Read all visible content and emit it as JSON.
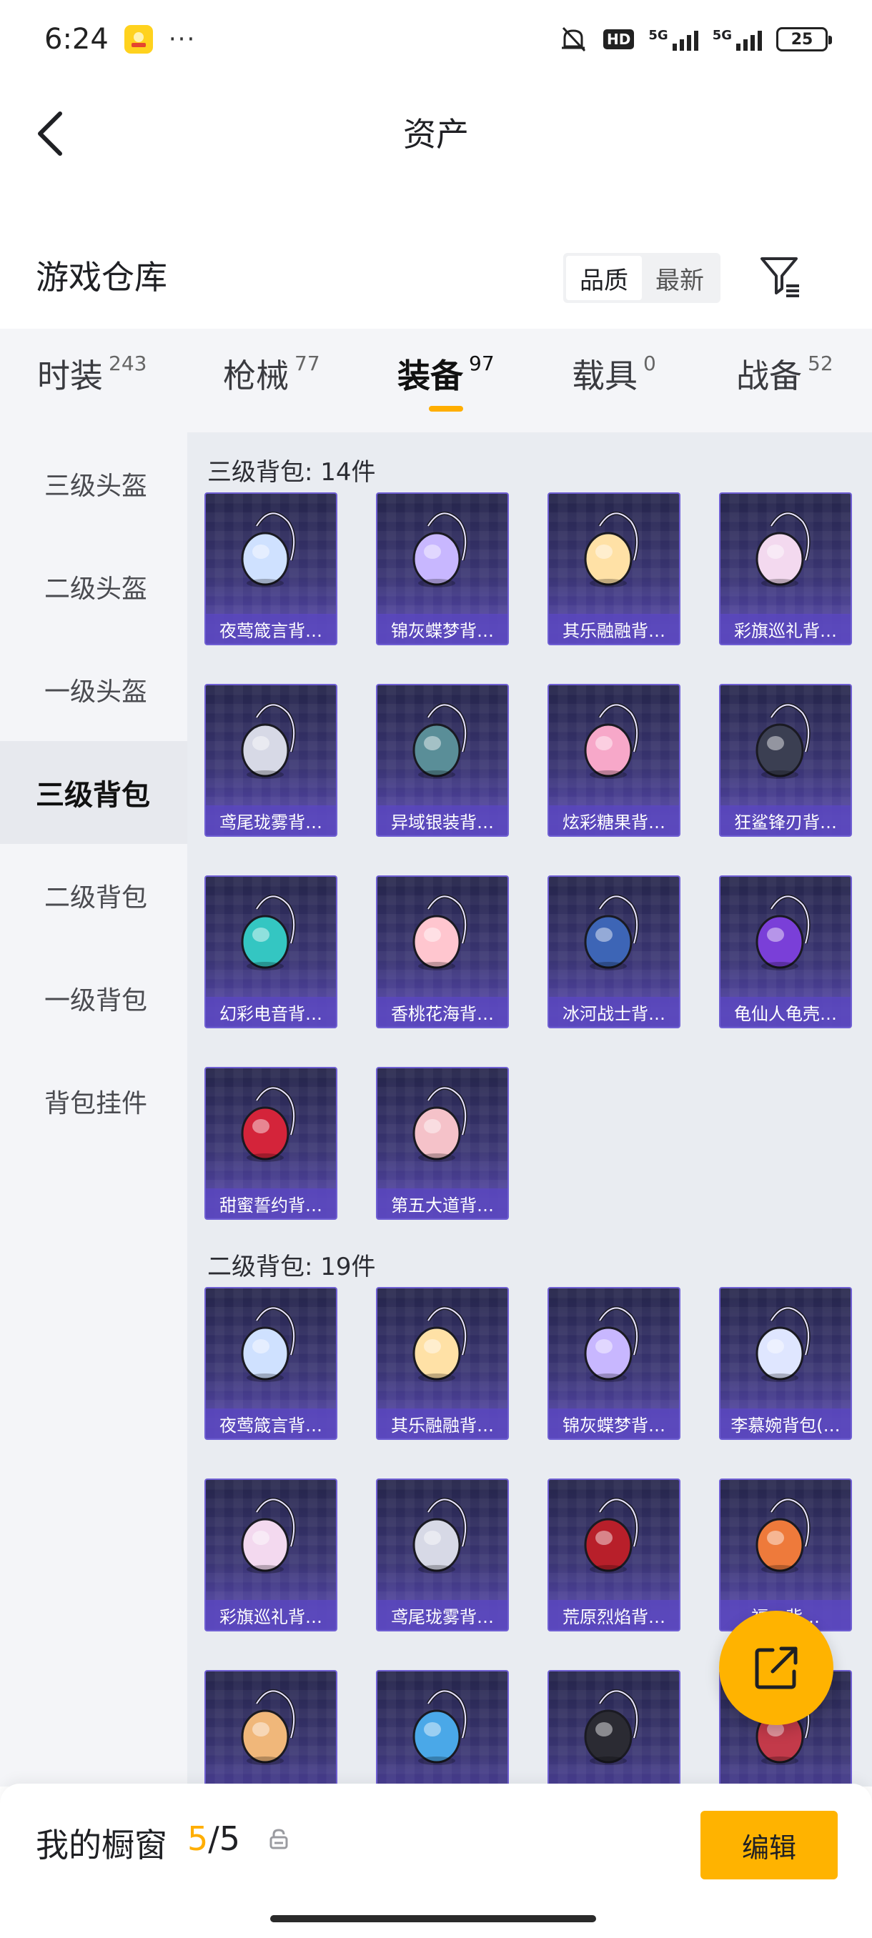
{
  "status_bar": {
    "time": "6:24",
    "dots": "···",
    "hd_label": "HD",
    "net1": "5G",
    "net2": "5G",
    "battery": "25"
  },
  "nav": {
    "title": "资产"
  },
  "warehouse": {
    "title": "游戏仓库",
    "sort_options": [
      "品质",
      "最新"
    ],
    "active_sort": 0
  },
  "tabs": [
    {
      "label": "时装",
      "count": "243"
    },
    {
      "label": "枪械",
      "count": "77"
    },
    {
      "label": "装备",
      "count": "97"
    },
    {
      "label": "载具",
      "count": "0"
    },
    {
      "label": "战备",
      "count": "52"
    }
  ],
  "active_tab": 2,
  "sidebar": [
    "三级头盔",
    "二级头盔",
    "一级头盔",
    "三级背包",
    "二级背包",
    "一级背包",
    "背包挂件"
  ],
  "active_sidebar": 3,
  "groups": [
    {
      "title": "三级背包: 14件",
      "items": [
        {
          "name": "夜莺箴言背…",
          "icon": "jellyfish-backpack-icon",
          "color": "#cfe1ff"
        },
        {
          "name": "锦灰蝶梦背…",
          "icon": "crystal-backpack-icon",
          "color": "#c8b7ff"
        },
        {
          "name": "其乐融融背…",
          "icon": "cupcake-backpack-icon",
          "color": "#ffe1a6"
        },
        {
          "name": "彩旗巡礼背…",
          "icon": "bow-backpack-icon",
          "color": "#f3d9ef"
        },
        {
          "name": "鸢尾珑雾背…",
          "icon": "silver-purse-backpack-icon",
          "color": "#d7d9e6"
        },
        {
          "name": "异域银装背…",
          "icon": "tactical-backpack-icon",
          "color": "#5a8e98"
        },
        {
          "name": "炫彩糖果背…",
          "icon": "donut-backpack-icon",
          "color": "#f7a8c9"
        },
        {
          "name": "狂鲨锋刃背…",
          "icon": "shark-backpack-icon",
          "color": "#3b3f52"
        },
        {
          "name": "幻彩电音背…",
          "icon": "speaker-backpack-icon",
          "color": "#34c6c2"
        },
        {
          "name": "香桃花海背…",
          "icon": "dress-backpack-icon",
          "color": "#ffc6cf"
        },
        {
          "name": "冰河战士背…",
          "icon": "astronaut-backpack-icon",
          "color": "#3d65b6"
        },
        {
          "name": "龟仙人龟壳…",
          "icon": "turtle-shell-backpack-icon",
          "color": "#7a3fd8"
        },
        {
          "name": "甜蜜誓约背…",
          "icon": "heart-wing-backpack-icon",
          "color": "#d4243a"
        },
        {
          "name": "第五大道背…",
          "icon": "pink-quilted-backpack-icon",
          "color": "#f5c2c9"
        }
      ]
    },
    {
      "title": "二级背包: 19件",
      "items": [
        {
          "name": "夜莺箴言背…",
          "icon": "jellyfish-backpack-icon",
          "color": "#cfe1ff"
        },
        {
          "name": "其乐融融背…",
          "icon": "cupcake-backpack-icon",
          "color": "#ffe1a6"
        },
        {
          "name": "锦灰蝶梦背…",
          "icon": "crystal-backpack-icon",
          "color": "#c8b7ff"
        },
        {
          "name": "李慕婉背包(…",
          "icon": "lace-backpack-icon",
          "color": "#dfe6ff"
        },
        {
          "name": "彩旗巡礼背…",
          "icon": "bow-backpack-icon",
          "color": "#f3d9ef"
        },
        {
          "name": "鸢尾珑雾背…",
          "icon": "silver-purse-backpack-icon",
          "color": "#d7d9e6"
        },
        {
          "name": "荒原烈焰背…",
          "icon": "flame-backpack-icon",
          "color": "#b81f2a"
        },
        {
          "name": "福…背…",
          "icon": "bunny-backpack-icon",
          "color": "#ee7a3b"
        },
        {
          "name": "",
          "icon": "cookie-backpack-icon",
          "color": "#f0b77a"
        },
        {
          "name": "",
          "icon": "blue-mech-backpack-icon",
          "color": "#4aa8e8"
        },
        {
          "name": "",
          "icon": "black-shark-backpack-icon",
          "color": "#2b2b33"
        },
        {
          "name": "",
          "icon": "robot-backpack-icon",
          "color": "#c33a4a"
        }
      ]
    }
  ],
  "fab": {
    "icon": "share-icon"
  },
  "bottom_bar": {
    "label": "我的橱窗",
    "count_current": "5",
    "count_total": "/5",
    "edit_label": "编辑"
  },
  "colors": {
    "accent": "#ffb300",
    "card_border": "#6f5fd3",
    "sidebar_bg": "#f4f5f8",
    "content_bg": "#e9ecf1"
  }
}
